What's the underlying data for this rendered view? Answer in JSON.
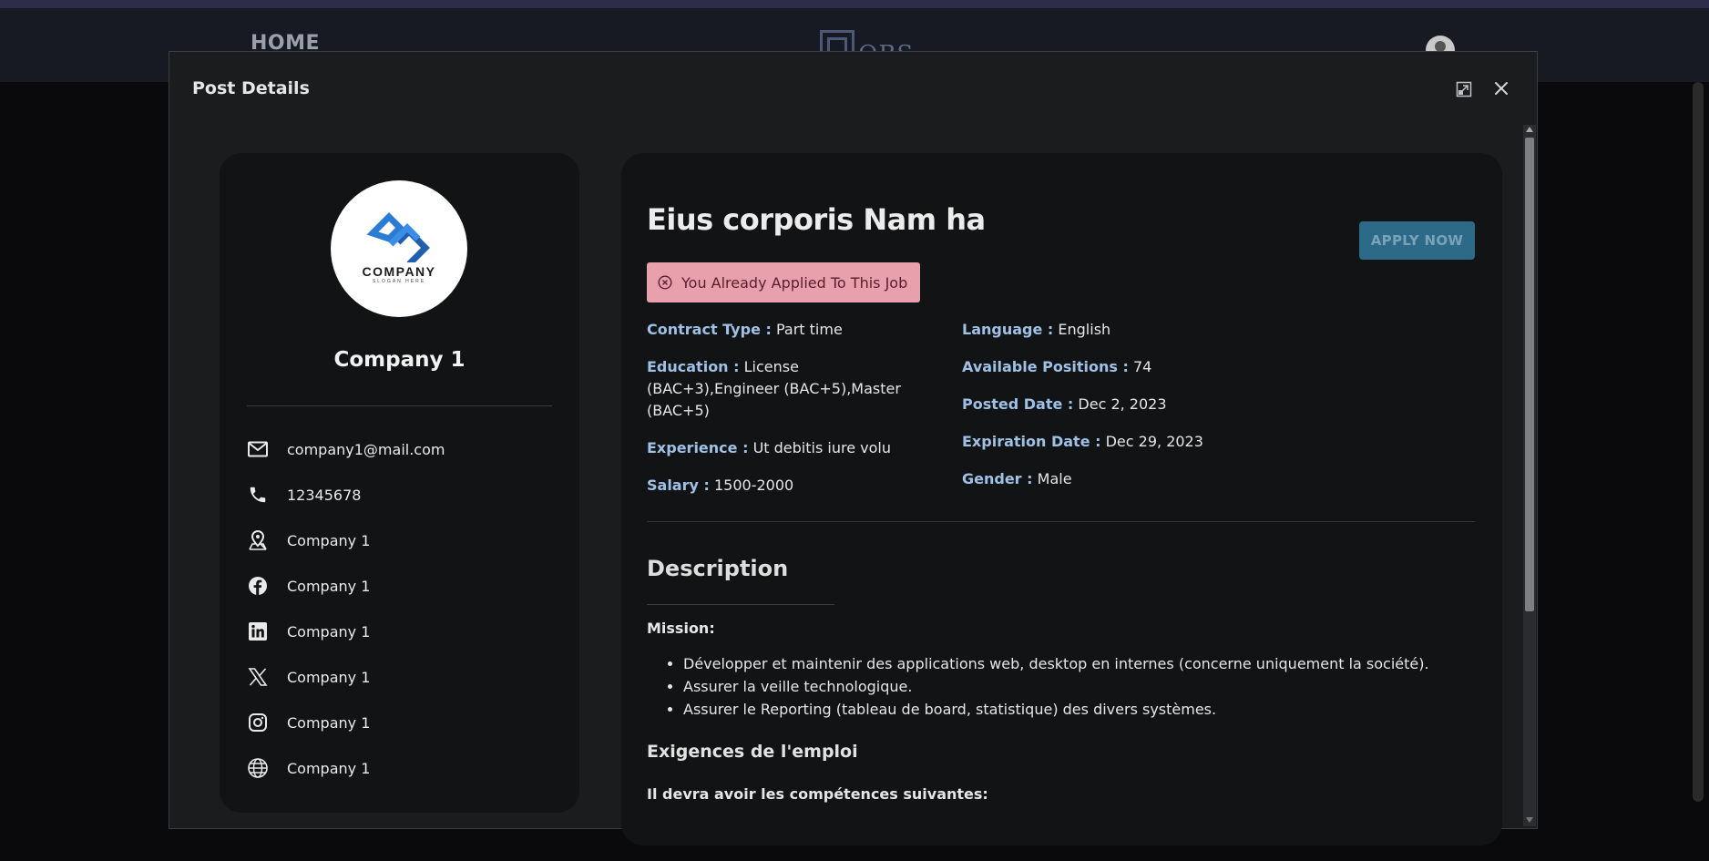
{
  "nav": {
    "home_label": "HOME",
    "logo_text": "OBS"
  },
  "modal": {
    "title": "Post Details"
  },
  "company": {
    "logo_word": "COMPANY",
    "logo_slogan": "SLOGAN HERE",
    "name": "Company 1",
    "contacts": {
      "email": "company1@mail.com",
      "phone": "12345678",
      "address": "Company 1",
      "facebook": "Company 1",
      "linkedin": "Company 1",
      "x": "Company 1",
      "instagram": "Company 1",
      "website": "Company 1"
    }
  },
  "job": {
    "title": "Eius corporis Nam ha",
    "apply_label": "APPLY NOW",
    "applied_message": "You Already Applied To This Job",
    "details_left": [
      {
        "label": "Contract Type :",
        "value": "Part time"
      },
      {
        "label": "Education :",
        "value": "License (BAC+3),Engineer (BAC+5),Master (BAC+5)"
      },
      {
        "label": "Experience :",
        "value": "Ut debitis iure volu"
      },
      {
        "label": "Salary :",
        "value": "1500-2000"
      }
    ],
    "details_right": [
      {
        "label": "Language :",
        "value": "English"
      },
      {
        "label": "Available Positions :",
        "value": "74"
      },
      {
        "label": "Posted Date :",
        "value": "Dec 2, 2023"
      },
      {
        "label": "Expiration Date :",
        "value": "Dec 29, 2023"
      },
      {
        "label": "Gender :",
        "value": "Male"
      }
    ],
    "description": {
      "title": "Description",
      "mission_label": "Mission:",
      "missions": [
        "Développer et maintenir des applications web, desktop en internes (concerne uniquement la société).",
        "Assurer la veille technologique.",
        "Assurer le Reporting (tableau de board, statistique) des divers systèmes."
      ],
      "requirements_title": "Exigences de l'emploi",
      "requirements_sub": "Il devra avoir les compétences suivantes:"
    }
  },
  "colors": {
    "label_accent": "#9fc1e6",
    "apply_button": "#2d6a88",
    "alert_bg": "#e8a0ad"
  }
}
